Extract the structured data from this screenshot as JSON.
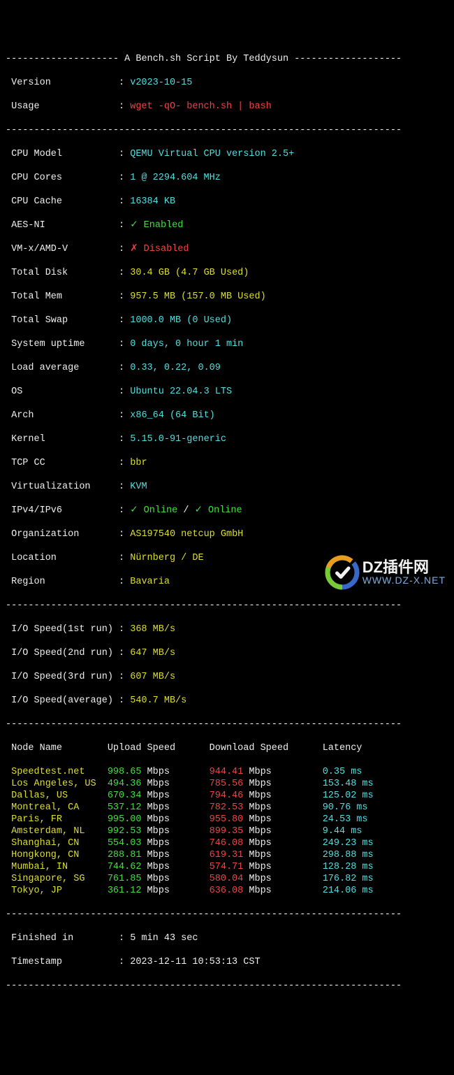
{
  "header": {
    "dashes_left": "-------------------- ",
    "title": "A Bench.sh Script By Teddysun",
    "dashes_right": " -------------------"
  },
  "meta": {
    "version_label": " Version",
    "version_sep": "            : ",
    "version": "v2023-10-15",
    "usage_label": " Usage",
    "usage_sep": "              : ",
    "usage": "wget -qO- bench.sh | bash"
  },
  "divider": "----------------------------------------------------------------------",
  "sys": {
    "cpu_model_label": " CPU Model",
    "cpu_model_sep": "          : ",
    "cpu_model": "QEMU Virtual CPU version 2.5+",
    "cpu_cores_label": " CPU Cores",
    "cpu_cores_sep": "          : ",
    "cpu_cores": "1 @ 2294.604 MHz",
    "cpu_cache_label": " CPU Cache",
    "cpu_cache_sep": "          : ",
    "cpu_cache": "16384 KB",
    "aes_label": " AES-NI",
    "aes_sep": "             : ",
    "aes_mark": "✓ ",
    "aes_value": "Enabled",
    "vmx_label": " VM-x/AMD-V",
    "vmx_sep": "         : ",
    "vmx_mark": "✗ ",
    "vmx_value": "Disabled",
    "disk_label": " Total Disk",
    "disk_sep": "         : ",
    "disk": "30.4 GB (4.7 GB Used)",
    "mem_label": " Total Mem",
    "mem_sep": "          : ",
    "mem": "957.5 MB (157.0 MB Used)",
    "swap_label": " Total Swap",
    "swap_sep": "         : ",
    "swap": "1000.0 MB (0 Used)",
    "uptime_label": " System uptime",
    "uptime_sep": "      : ",
    "uptime": "0 days, 0 hour 1 min",
    "load_label": " Load average",
    "load_sep": "       : ",
    "load": "0.33, 0.22, 0.09",
    "os_label": " OS",
    "os_sep": "                 : ",
    "os": "Ubuntu 22.04.3 LTS",
    "arch_label": " Arch",
    "arch_sep": "               : ",
    "arch": "x86_64 (64 Bit)",
    "kernel_label": " Kernel",
    "kernel_sep": "             : ",
    "kernel": "5.15.0-91-generic",
    "tcp_label": " TCP CC",
    "tcp_sep": "             : ",
    "tcp": "bbr",
    "virt_label": " Virtualization",
    "virt_sep": "     : ",
    "virt": "KVM",
    "ip_label": " IPv4/IPv6",
    "ip_sep": "          : ",
    "ip_v4_mark": "✓ ",
    "ip_v4": "Online",
    "ip_slash": " / ",
    "ip_v6_mark": "✓ ",
    "ip_v6": "Online",
    "org_label": " Organization",
    "org_sep": "       : ",
    "org": "AS197540 netcup GmbH",
    "loc_label": " Location",
    "loc_sep": "           : ",
    "loc": "Nürnberg / DE",
    "region_label": " Region",
    "region_sep": "             : ",
    "region": "Bavaria"
  },
  "io": {
    "r1_label": " I/O Speed(1st run) : ",
    "r1": "368 MB/s",
    "r2_label": " I/O Speed(2nd run) : ",
    "r2": "647 MB/s",
    "r3_label": " I/O Speed(3rd run) : ",
    "r3": "607 MB/s",
    "avg_label": " I/O Speed(average) : ",
    "avg": "540.7 MB/s"
  },
  "speed_header": {
    "node": " Node Name",
    "upload": "Upload Speed",
    "download": "Download Speed",
    "latency": "Latency"
  },
  "speedtest": [
    {
      "name": " Speedtest.net",
      "up_v": "998.65",
      "up_u": " Mbps",
      "dn_v": "944.41",
      "dn_u": " Mbps",
      "lat": "0.35 ms"
    },
    {
      "name": " Los Angeles, US",
      "up_v": "494.36",
      "up_u": " Mbps",
      "dn_v": "785.56",
      "dn_u": " Mbps",
      "lat": "153.48 ms"
    },
    {
      "name": " Dallas, US",
      "up_v": "670.34",
      "up_u": " Mbps",
      "dn_v": "794.46",
      "dn_u": " Mbps",
      "lat": "125.02 ms"
    },
    {
      "name": " Montreal, CA",
      "up_v": "537.12",
      "up_u": " Mbps",
      "dn_v": "782.53",
      "dn_u": " Mbps",
      "lat": "90.76 ms"
    },
    {
      "name": " Paris, FR",
      "up_v": "995.00",
      "up_u": " Mbps",
      "dn_v": "955.80",
      "dn_u": " Mbps",
      "lat": "24.53 ms"
    },
    {
      "name": " Amsterdam, NL",
      "up_v": "992.53",
      "up_u": " Mbps",
      "dn_v": "899.35",
      "dn_u": " Mbps",
      "lat": "9.44 ms"
    },
    {
      "name": " Shanghai, CN",
      "up_v": "554.03",
      "up_u": " Mbps",
      "dn_v": "746.08",
      "dn_u": " Mbps",
      "lat": "249.23 ms"
    },
    {
      "name": " Hongkong, CN",
      "up_v": "288.81",
      "up_u": " Mbps",
      "dn_v": "619.31",
      "dn_u": " Mbps",
      "lat": "298.88 ms"
    },
    {
      "name": " Mumbai, IN",
      "up_v": "744.62",
      "up_u": " Mbps",
      "dn_v": "574.71",
      "dn_u": " Mbps",
      "lat": "128.28 ms"
    },
    {
      "name": " Singapore, SG",
      "up_v": "761.85",
      "up_u": " Mbps",
      "dn_v": "580.04",
      "dn_u": " Mbps",
      "lat": "176.82 ms"
    },
    {
      "name": " Tokyo, JP",
      "up_v": "361.12",
      "up_u": " Mbps",
      "dn_v": "636.08",
      "dn_u": " Mbps",
      "lat": "214.06 ms"
    }
  ],
  "footer": {
    "finished_label": " Finished in",
    "finished_sep": "        : ",
    "finished": "5 min 43 sec",
    "timestamp_label": " Timestamp",
    "timestamp_sep": "          : ",
    "timestamp": "2023-12-11 10:53:13 CST"
  },
  "watermark": {
    "line1": "DZ插件网",
    "line2": "WWW.DZ-X.NET"
  }
}
